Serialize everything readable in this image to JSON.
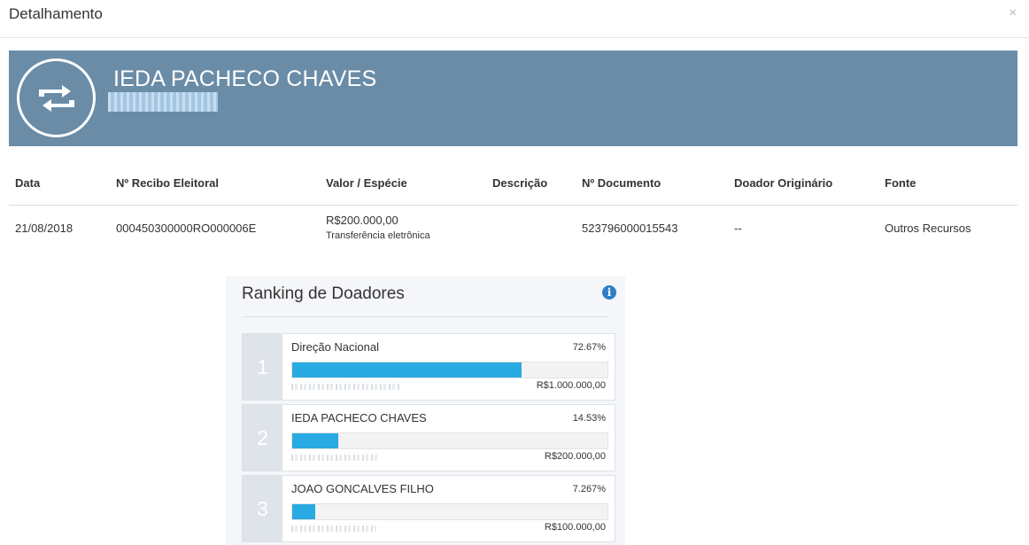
{
  "modal": {
    "title": "Detalhamento",
    "close": "×"
  },
  "banner": {
    "name": "IEDA PACHECO CHAVES",
    "icon": "transfer-arrows-icon",
    "color": "#6a8ca7"
  },
  "table": {
    "headers": [
      "Data",
      "Nº Recibo Eleitoral",
      "Valor / Espécie",
      "Descrição",
      "Nº Documento",
      "Doador Originário",
      "Fonte"
    ],
    "row": {
      "data": "21/08/2018",
      "recibo": "000450300000RO000006E",
      "valor": "R$200.000,00",
      "especie": "Transferência eletrônica",
      "descricao": "",
      "documento": "523796000015543",
      "doador_originario": "--",
      "fonte": "Outros Recursos"
    }
  },
  "ranking": {
    "title": "Ranking de Doadores",
    "info_icon": "info-icon",
    "items": [
      {
        "rank": "1",
        "name": "Direção Nacional",
        "percent": "72.67%",
        "fill": 0.7267,
        "amount": "R$1.000.000,00"
      },
      {
        "rank": "2",
        "name": "IEDA PACHECO CHAVES",
        "percent": "14.53%",
        "fill": 0.1453,
        "amount": "R$200.000,00"
      },
      {
        "rank": "3",
        "name": "JOAO GONCALVES FILHO",
        "percent": "7.267%",
        "fill": 0.07267,
        "amount": "R$100.000,00"
      }
    ],
    "bar_color": "#2aaae2"
  }
}
